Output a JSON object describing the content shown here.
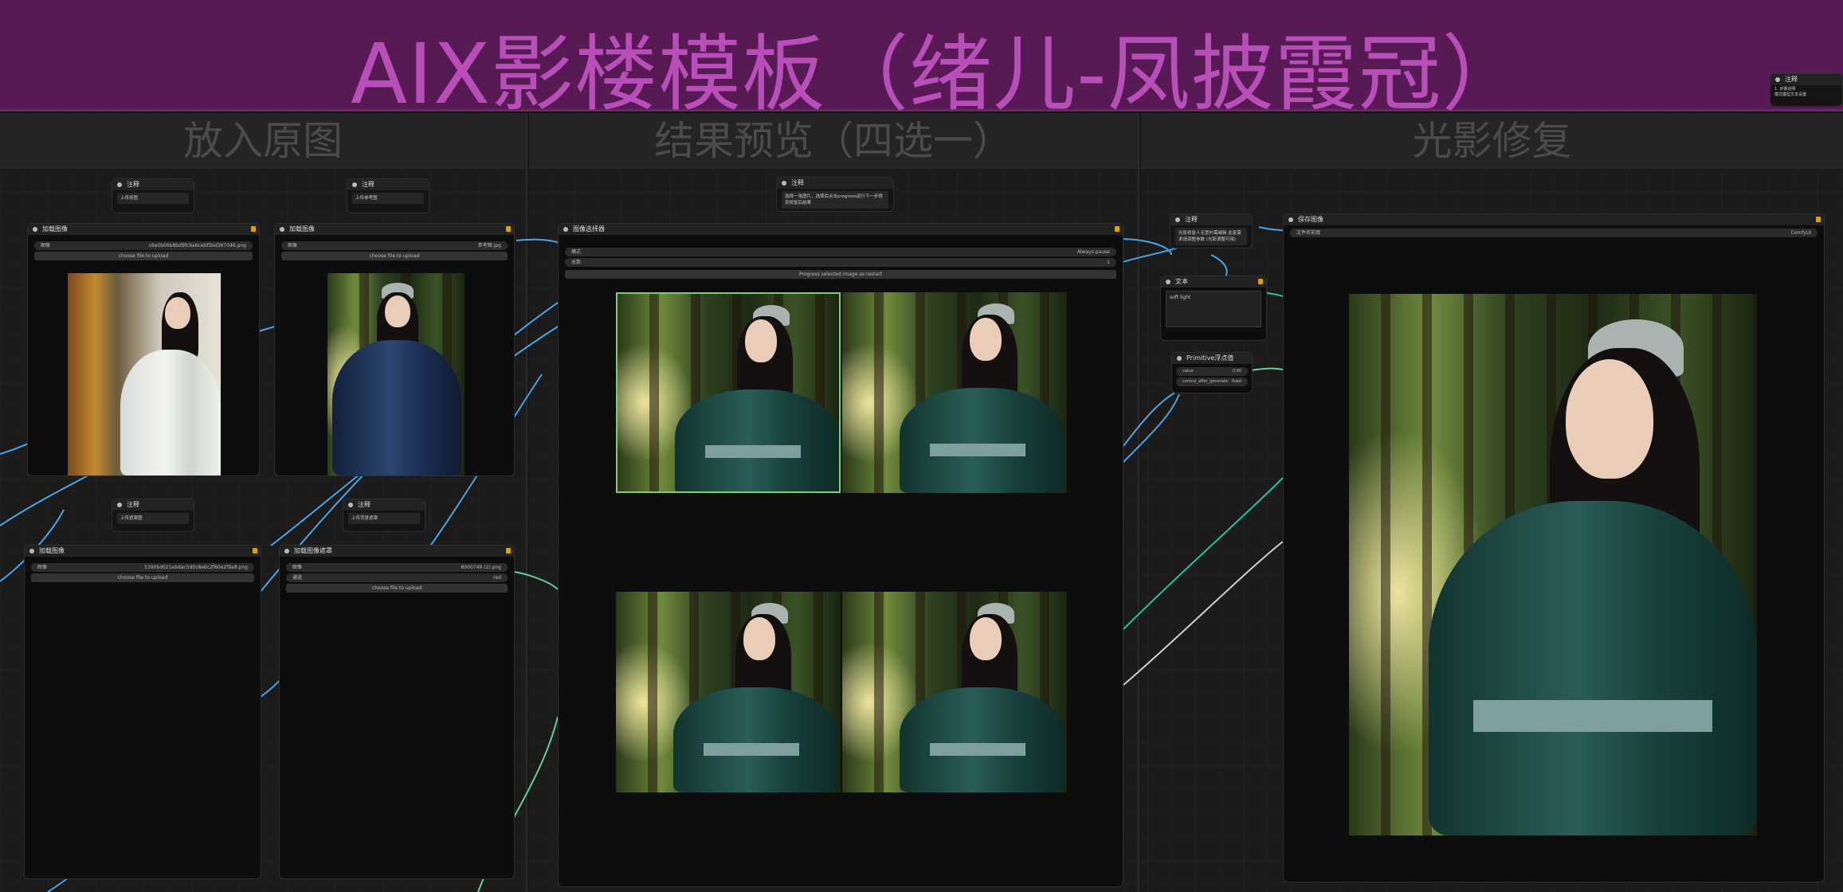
{
  "banner": {
    "title": "AIX影楼模板（绪儿-凤披霞冠）"
  },
  "groups": {
    "input": "放入原图",
    "preview": "结果预览（四选一）",
    "relight": "光影修复"
  },
  "corner_note": {
    "title": "注释",
    "line1": "1. 步骤说明",
    "line2": "模式模型文本设置"
  },
  "notes": {
    "n1": {
      "title": "注释",
      "text": "上传原图"
    },
    "n2": {
      "title": "注释",
      "text": "上传参考图"
    },
    "n3": {
      "title": "注释",
      "text": "选择一张图片，选择后点击progress运行下一步得到修复后结果"
    },
    "n4": {
      "title": "注释",
      "text": "上传遮罩图"
    },
    "n5": {
      "title": "注释",
      "text": "上传背景遮罩"
    },
    "n6": {
      "title": "注释",
      "text": "光影修复人无意外需编辑 此复需求请调整参数 (光影调整可用)"
    }
  },
  "load1": {
    "title": "加载图像",
    "label": "图像",
    "value": "c6e0b06b8bd9fc9a6cebf5bd367046.png",
    "upload": "choose file to upload"
  },
  "load2": {
    "title": "加载图像",
    "label": "图像",
    "value": "参考图.jpg",
    "upload": "choose file to upload"
  },
  "load3": {
    "title": "加载图像",
    "label": "图像",
    "value": "5390bd021ebdac5d0c8e6c2f60e2f9a8.png",
    "upload": "choose file to upload"
  },
  "load4": {
    "title": "加载图像遮罩",
    "w1_label": "图像",
    "w1_value": "8000749 (2).png",
    "w2_label": "通道",
    "w2_value": "red",
    "upload": "choose file to upload"
  },
  "chooser": {
    "title": "图像选择器",
    "w1_label": "模式",
    "w1_value": "Always pause",
    "w2_label": "总数",
    "w2_value": "1",
    "button": "Progress selected image as restart"
  },
  "textnode": {
    "title": "文本",
    "text": "soft light"
  },
  "prim": {
    "title": "Primitive浮点值",
    "w1_label": "value",
    "w1_value": "0.80",
    "w2_label": "control_after_generate",
    "w2_value": "fixed"
  },
  "save": {
    "title": "保存图像",
    "label": "文件名前缀",
    "value": "ComfyUI"
  },
  "icons": [
    "lock-icon",
    "node-dot-icon"
  ]
}
